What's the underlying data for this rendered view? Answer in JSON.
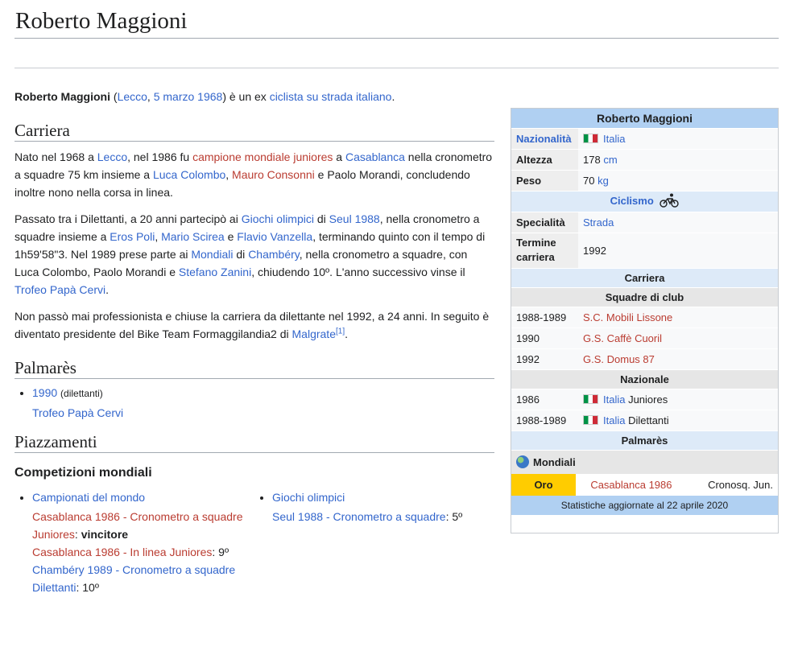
{
  "title": "Roberto Maggioni",
  "lead": {
    "name": "Roberto Maggioni",
    "open": " (",
    "birthplace": "Lecco",
    "comma": ", ",
    "birthdate": "5 marzo 1968",
    "mid": ") è un ex ",
    "occupation": "ciclista su strada italiano",
    "end": "."
  },
  "sections": {
    "carriera": {
      "heading": "Carriera",
      "p1": {
        "t1": "Nato nel 1968 a ",
        "l1": "Lecco",
        "t2": ", nel 1986 fu ",
        "l2": "campione mondiale juniores",
        "t3": " a ",
        "l3": "Casablanca",
        "t4": " nella cronometro a squadre 75 km insieme a ",
        "l4": "Luca Colombo",
        "t5": ", ",
        "l5": "Mauro Consonni",
        "t6": " e Paolo Morandi, concludendo inoltre nono nella corsa in linea."
      },
      "p2": {
        "t1": "Passato tra i Dilettanti, a 20 anni partecipò ai ",
        "l1": "Giochi olimpici",
        "t2": " di ",
        "l2": "Seul 1988",
        "t3": ", nella cronometro a squadre insieme a ",
        "l3": "Eros Poli",
        "t4": ", ",
        "l4": "Mario Scirea",
        "t5": " e ",
        "l5": "Flavio Vanzella",
        "t6": ", terminando quinto con il tempo di 1h59'58\"3. Nel 1989 prese parte ai ",
        "l6": "Mondiali",
        "t7": " di ",
        "l7": "Chambéry",
        "t8": ", nella cronometro a squadre, con Luca Colombo, Paolo Morandi e ",
        "l8": "Stefano Zanini",
        "t9": ", chiudendo 10º. L'anno successivo vinse il ",
        "l9": "Trofeo Papà Cervi",
        "t10": "."
      },
      "p3": {
        "t1": "Non passò mai professionista e chiuse la carriera da dilettante nel 1992, a 24 anni. In seguito è diventato presidente del Bike Team Formaggilandia2 di ",
        "l1": "Malgrate",
        "ref": "[1]",
        "t2": "."
      }
    },
    "palmares": {
      "heading": "Palmarès",
      "year": "1990",
      "note": "(dilettanti)",
      "race": "Trofeo Papà Cervi"
    },
    "piazzamenti": {
      "heading": "Piazzamenti",
      "subheading": "Competizioni mondiali",
      "left": {
        "title": "Campionati del mondo",
        "e1_link": "Casablanca 1986 - Cronometro a squadre Juniores",
        "e1_sep": ": ",
        "e1_result": "vincitore",
        "e2_link": "Casablanca 1986 - In linea Juniores",
        "e2_result": ": 9º",
        "e3_link": "Chambéry 1989 - Cronometro a squadre Dilettanti",
        "e3_result": ": 10º"
      },
      "right": {
        "title": "Giochi olimpici",
        "e1_link": "Seul 1988 - Cronometro a squadre",
        "e1_result": ": 5º"
      }
    }
  },
  "infobox": {
    "title": "Roberto Maggioni",
    "nazionalita_label": "Nazionalità",
    "nazionalita_value": "Italia",
    "altezza_label": "Altezza",
    "altezza_value": "178",
    "altezza_unit": "cm",
    "peso_label": "Peso",
    "peso_value": "70",
    "peso_unit": "kg",
    "sport": "Ciclismo",
    "specialita_label": "Specialità",
    "specialita_value": "Strada",
    "termine_label": "Termine carriera",
    "termine_value": "1992",
    "carriera_heading": "Carriera",
    "club_heading": "Squadre di club",
    "clubs": [
      {
        "years": "1988-1989",
        "team": "S.C. Mobili Lissone"
      },
      {
        "years": "1990",
        "team": "G.S. Caffè Cuoril"
      },
      {
        "years": "1992",
        "team": "G.S. Domus 87"
      }
    ],
    "nazionale_heading": "Nazionale",
    "national": [
      {
        "years": "1986",
        "country": "Italia",
        "category": " Juniores"
      },
      {
        "years": "1988-1989",
        "country": "Italia",
        "category": " Dilettanti"
      }
    ],
    "palmares_heading": "Palmarès",
    "mondiali_label": "Mondiali",
    "medal": "Oro",
    "medal_event": "Casablanca 1986",
    "medal_discipline": "Cronosq. Jun.",
    "footer": "Statistiche aggiornate al 22 aprile 2020"
  },
  "colors": {
    "link": "#3366cc",
    "redlink": "#ba3c31",
    "infobox_header": "#b0d0f2",
    "gold": "#ffcc00"
  }
}
